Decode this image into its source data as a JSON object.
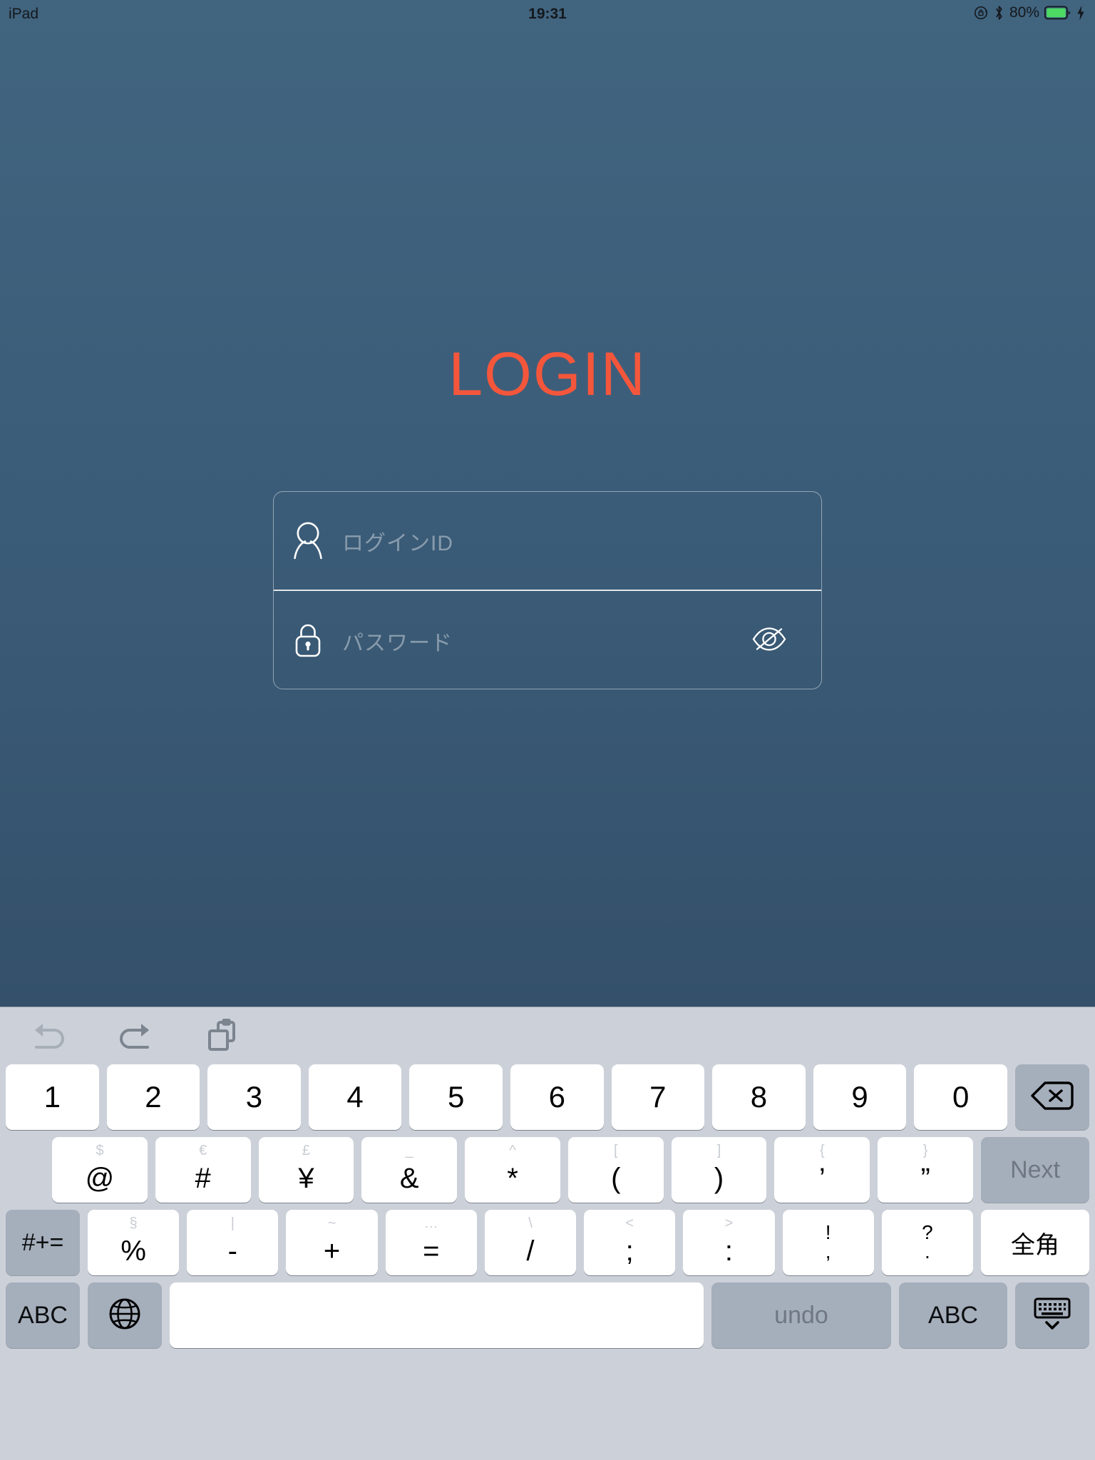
{
  "status_bar": {
    "device_label": "iPad",
    "time": "19:31",
    "battery_percent": "80%",
    "icons": [
      "rotation-lock-icon",
      "bluetooth-icon",
      "battery-icon",
      "charging-bolt-icon"
    ],
    "battery_color": "#4cd964",
    "text_color": "#14181c"
  },
  "screen": {
    "background_top": "#41647f",
    "background_bottom": "#2d4257"
  },
  "login": {
    "title": "LOGIN",
    "title_color": "#f4563c",
    "fields": [
      {
        "name": "login-id",
        "icon": "person-icon",
        "placeholder": "ログインID",
        "value": ""
      },
      {
        "name": "password",
        "icon": "lock-icon",
        "placeholder": "パスワード",
        "value": "",
        "trailing_icon": "eye-slash-icon"
      }
    ]
  },
  "keyboard": {
    "toolbar": [
      {
        "name": "undo-icon",
        "state": "disabled"
      },
      {
        "name": "redo-icon",
        "state": "enabled"
      },
      {
        "name": "paste-icon",
        "state": "enabled"
      }
    ],
    "row1": [
      {
        "primary": "1"
      },
      {
        "primary": "2"
      },
      {
        "primary": "3"
      },
      {
        "primary": "4"
      },
      {
        "primary": "5"
      },
      {
        "primary": "6"
      },
      {
        "primary": "7"
      },
      {
        "primary": "8"
      },
      {
        "primary": "9"
      },
      {
        "primary": "0"
      }
    ],
    "backspace": {
      "icon": "backspace-icon"
    },
    "row2": [
      {
        "secondary": "$",
        "primary": "@"
      },
      {
        "secondary": "€",
        "primary": "#"
      },
      {
        "secondary": "£",
        "primary": "¥"
      },
      {
        "secondary": "_",
        "primary": "&"
      },
      {
        "secondary": "^",
        "primary": "*"
      },
      {
        "secondary": "[",
        "primary": "("
      },
      {
        "secondary": "]",
        "primary": ")"
      },
      {
        "secondary": "{",
        "primary": "’"
      },
      {
        "secondary": "}",
        "primary": "”"
      }
    ],
    "next_key": "Next",
    "symbol_shift_key": "#+=",
    "row3": [
      {
        "secondary": "§",
        "primary": "%"
      },
      {
        "secondary": "|",
        "primary": "-"
      },
      {
        "secondary": "~",
        "primary": "+"
      },
      {
        "secondary": "…",
        "primary": "="
      },
      {
        "secondary": "\\",
        "primary": "/"
      },
      {
        "secondary": "<",
        "primary": ";"
      },
      {
        "secondary": ">",
        "primary": ":"
      }
    ],
    "row3_stacked": [
      {
        "top": "!",
        "bottom": ","
      },
      {
        "top": "?",
        "bottom": "."
      }
    ],
    "zenkaku_key": "全角",
    "row4": {
      "abc_left": "ABC",
      "globe": "globe-icon",
      "space": "",
      "undo": "undo",
      "abc_right": "ABC",
      "dismiss": "dismiss-keyboard-icon"
    }
  }
}
